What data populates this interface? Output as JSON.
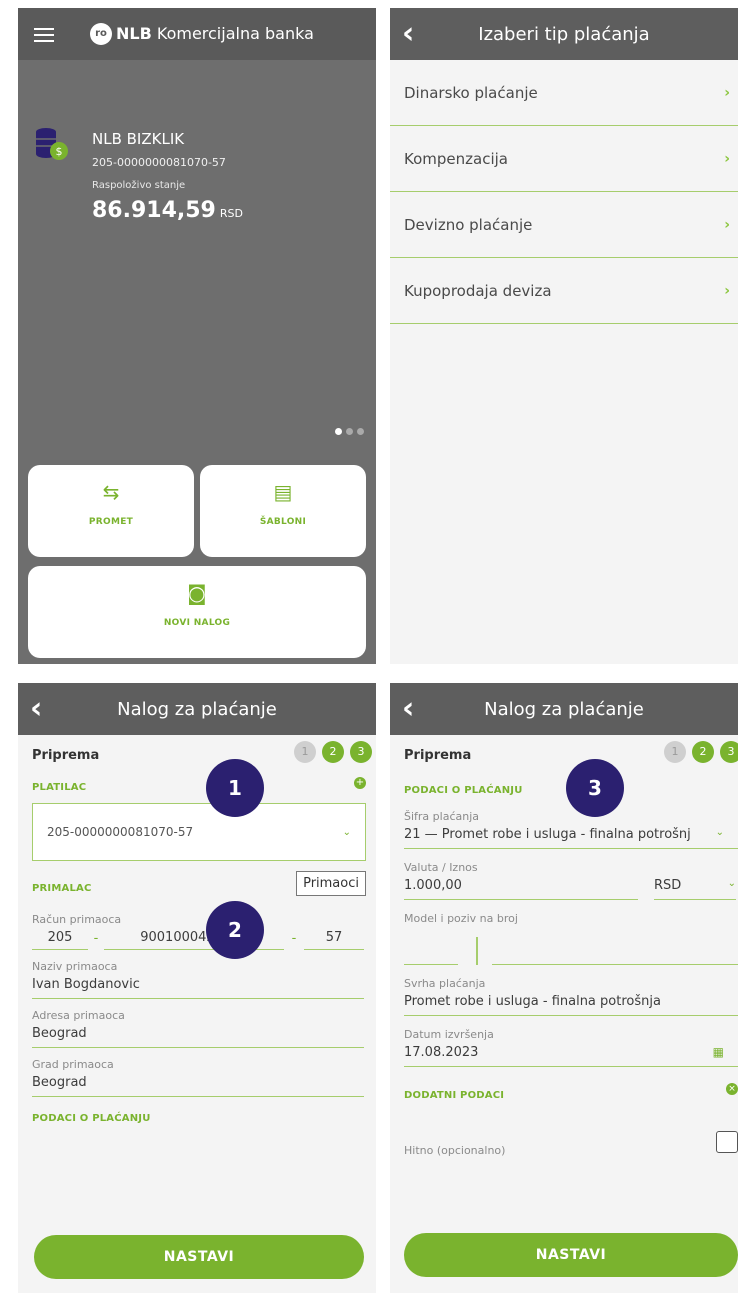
{
  "screen1": {
    "bank_name_bold": "NLB",
    "bank_name_rest": " Komercijalna banka",
    "account_name": "NLB BIZKLIK",
    "account_number": "205-0000000081070-57",
    "balance_label": "Raspoloživo stanje",
    "balance": "86.914,59",
    "currency": "RSD",
    "tiles": {
      "promet": "PROMET",
      "sabloni": "ŠABLONI",
      "novi": "NOVI NALOG"
    }
  },
  "screen2": {
    "title": "Izaberi tip plaćanja",
    "items": [
      "Dinarsko plaćanje",
      "Kompenzacija",
      "Devizno plaćanje",
      "Kupoprodaja deviza"
    ]
  },
  "screen3": {
    "title": "Nalog za plaćanje",
    "priprema": "Priprema",
    "steps": [
      "1",
      "2",
      "3"
    ],
    "platilac": "PLATILAC",
    "payer_account": "205-0000000081070-57",
    "primalac": "PRIMALAC",
    "primaoci_button": "Primaoci",
    "recipient_account_label": "Račun primaoca",
    "recipient_account": [
      "205",
      "-",
      "9001000421056",
      "-",
      "57"
    ],
    "recipient_name_label": "Naziv primaoca",
    "recipient_name": "Ivan Bogdanovic",
    "recipient_address_label": "Adresa primaoca",
    "recipient_address": "Beograd",
    "recipient_city_label": "Grad primaoca",
    "recipient_city": "Beograd",
    "payment_data": "PODACI O PLAĆANJU",
    "continue": "NASTAVI",
    "badges": [
      "1",
      "2"
    ]
  },
  "screen4": {
    "title": "Nalog za plaćanje",
    "priprema": "Priprema",
    "steps": [
      "1",
      "2",
      "3"
    ],
    "payment_data": "PODACI O PLAĆANJU",
    "code_label": "Šifra plaćanja",
    "code_value": "21 — Promet robe i usluga - finalna potrošnj",
    "amount_label": "Valuta / Iznos",
    "amount": "1.000,00",
    "currency": "RSD",
    "model_label": "Model i poziv na broj",
    "purpose_label": "Svrha plaćanja",
    "purpose": "Promet robe i usluga - finalna potrošnja",
    "date_label": "Datum izvršenja",
    "date": "17.08.2023",
    "extra": "DODATNI PODACI",
    "urgent": "Hitno (opcionalno)",
    "continue": "NASTAVI",
    "badge": "3"
  },
  "colors": {
    "accent": "#7ab32e",
    "header": "#5e5e5e",
    "badge": "#2b2070"
  }
}
